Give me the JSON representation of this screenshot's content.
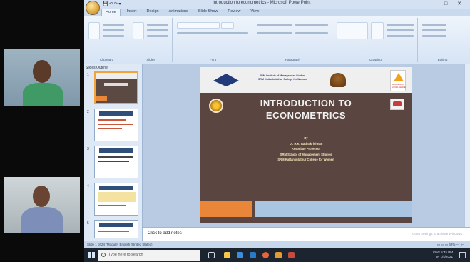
{
  "ppt": {
    "title": "Introduction to econometrics - Microsoft PowerPoint",
    "window_controls": "–  □  ✕",
    "quick_access": "💾 ↶ ↷ ▾",
    "tabs": [
      "Home",
      "Insert",
      "Design",
      "Animations",
      "Slide Show",
      "Review",
      "View"
    ],
    "ribbon_groups": [
      "Clipboard",
      "Slides",
      "Font",
      "Paragraph",
      "Drawing",
      "Editing"
    ],
    "pane_tabs": "Slides  Outline",
    "thumb_numbers": [
      "1",
      "2",
      "3",
      "4",
      "5"
    ]
  },
  "slide": {
    "header_text": "SRM Institute of Management Studies\nSRM Kattankulathur College for Women",
    "logo_text": "ACADEMIC EXCELLENCE",
    "title": "INTRODUCTION TO\nECONOMETRICS",
    "byline": "By\nDr. R.K. Radhakrishnan\nAssociate Professor\nSRM School of Management Studies\nSRM Kattankulathur College for Women"
  },
  "notes": {
    "placeholder": "Click to add notes",
    "ghost": "Go to Settings to activate Windows."
  },
  "status": {
    "left": "Slide 1 of 24    \"Module\"    English (United States)",
    "zoom": "▭ ▭ ▭  62% ─◯─"
  },
  "taskbar": {
    "search": "Type here to search",
    "tray": "ENG  5:45 PM\nIN   1/4/2021"
  },
  "colors": {
    "slide_bg": "#5b4541",
    "slide_title": "#f1f1f1",
    "accent_orange": "#e9863a",
    "accent_blue": "#a9c5e2",
    "ribbon": "#d6e4f5"
  }
}
